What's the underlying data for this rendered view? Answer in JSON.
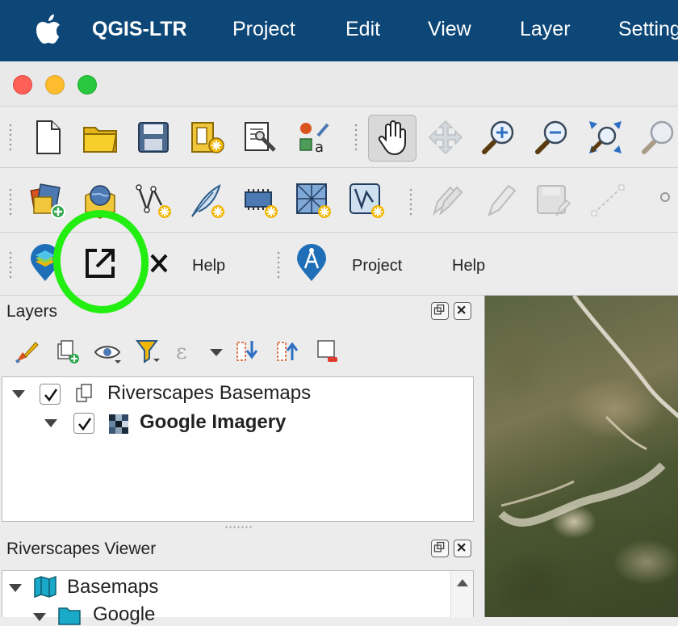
{
  "menubar": {
    "app_name": "QGIS-LTR",
    "items": [
      "Project",
      "Edit",
      "View",
      "Layer",
      "Settings"
    ]
  },
  "toolbar3": {
    "help_label_1": "Help",
    "project_label": "Project",
    "help_label_2": "Help"
  },
  "layers_panel": {
    "title": "Layers",
    "items": [
      {
        "label": "Riverscapes Basemaps",
        "checked": true
      },
      {
        "label": "Google Imagery",
        "checked": true
      }
    ]
  },
  "viewer_panel": {
    "title": "Riverscapes Viewer",
    "items": [
      {
        "label": "Basemaps"
      },
      {
        "label": "Google"
      }
    ]
  },
  "colors": {
    "menubar": "#0d4777",
    "highlight_circle": "#22ee11"
  }
}
